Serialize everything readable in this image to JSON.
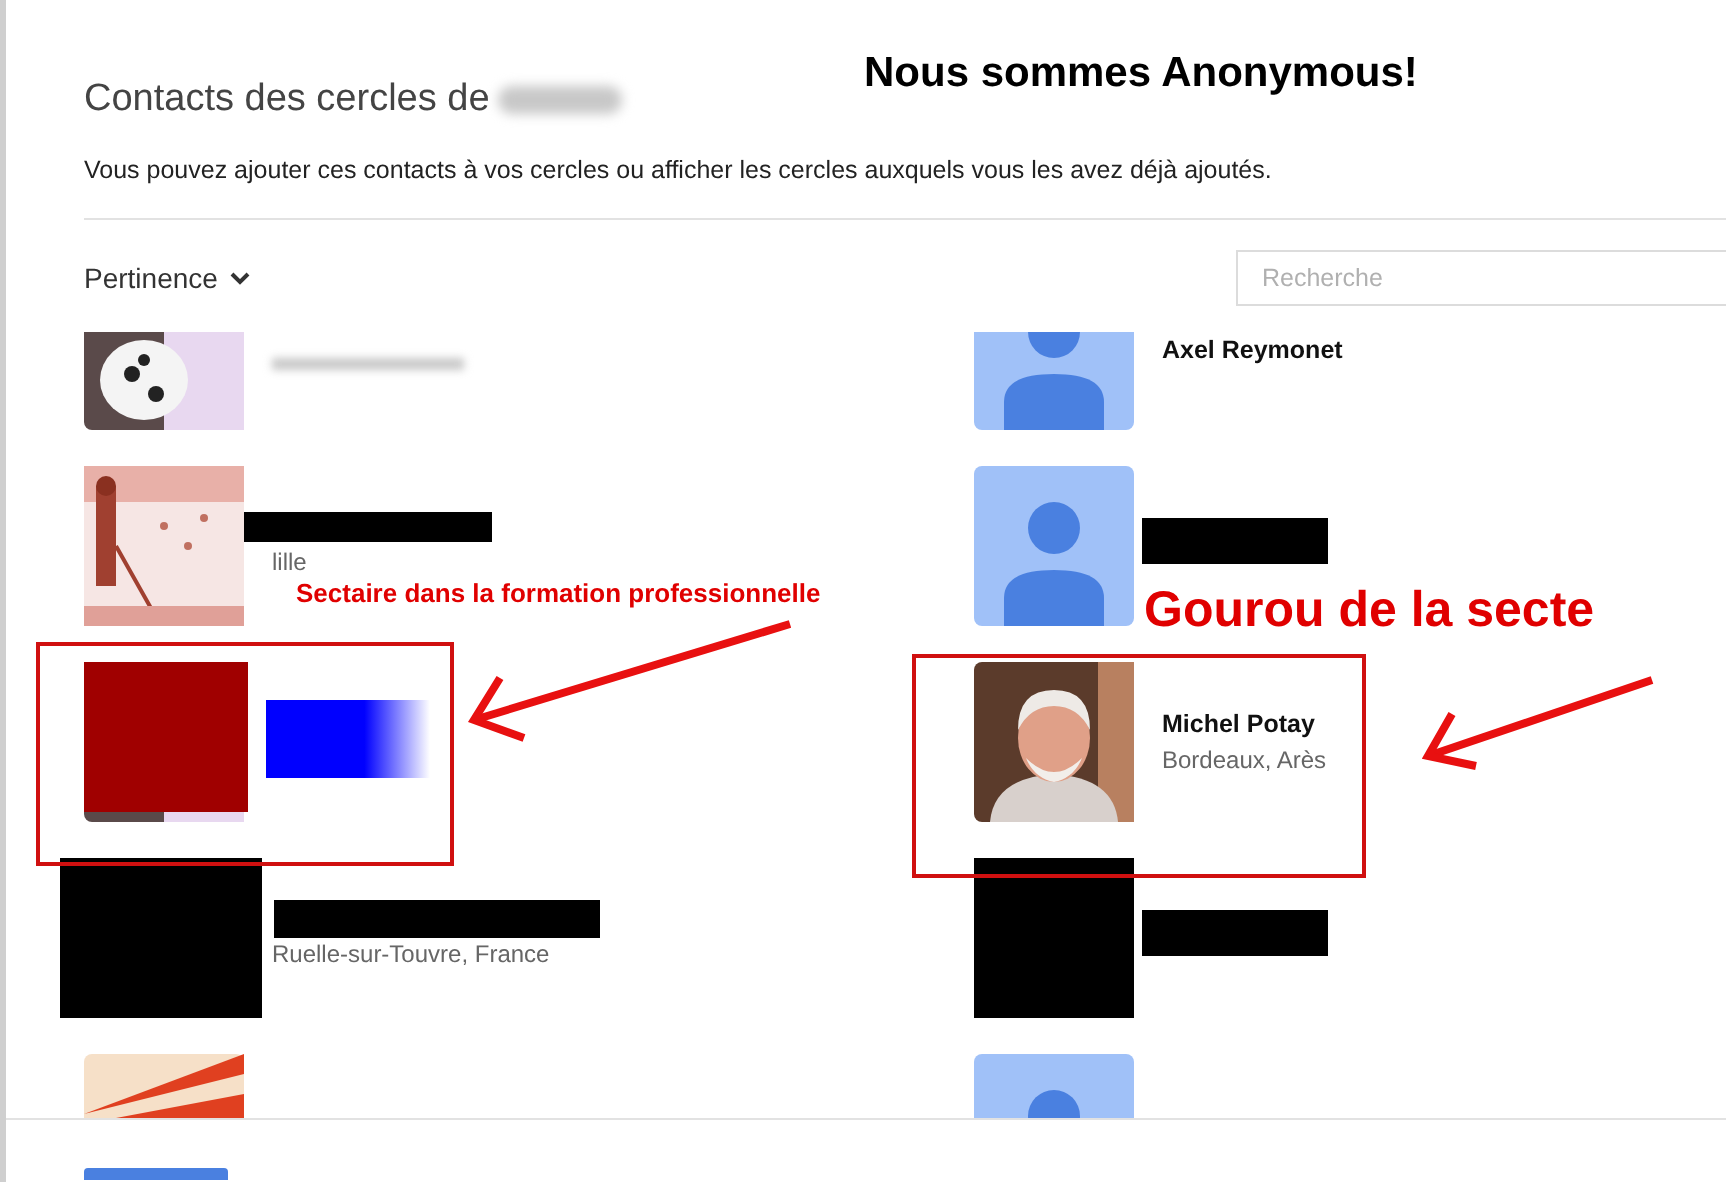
{
  "header": {
    "title": "Contacts des cercles de",
    "title_redaction": {
      "kind": "blur"
    },
    "subtitle": "Vous pouvez ajouter ces contacts à vos cercles ou afficher les cercles auxquels vous les avez déjà ajoutés."
  },
  "sort": {
    "label": "Pertinence"
  },
  "search": {
    "placeholder": "Recherche"
  },
  "contacts": [
    {
      "kind": "photo-dog",
      "redactions": [
        {
          "kind": "location-blur"
        }
      ]
    },
    {
      "kind": "default",
      "name": "Axel Reymonet"
    },
    {
      "kind": "photo-beach",
      "location": "lille",
      "redactions": [
        {
          "kind": "name-bar"
        }
      ]
    },
    {
      "kind": "default",
      "redactions": [
        {
          "kind": "name-bar-tall"
        }
      ]
    },
    {
      "kind": "photo-dog",
      "redactions": [
        {
          "kind": "photo-red"
        },
        {
          "kind": "name-blue"
        }
      ]
    },
    {
      "kind": "photo-man",
      "name": "Michel Potay",
      "location": "Bordeaux, Arès"
    },
    {
      "kind": "hidden",
      "location": "Ruelle-sur-Touvre, France",
      "redactions": [
        {
          "kind": "photo-black-wide"
        },
        {
          "kind": "name-bar-wide"
        }
      ]
    },
    {
      "kind": "hidden",
      "redactions": [
        {
          "kind": "photo-black"
        },
        {
          "kind": "name-bar-tall"
        }
      ]
    },
    {
      "kind": "photo-rays"
    },
    {
      "kind": "default"
    }
  ],
  "annotations": [
    {
      "kind": "headline",
      "text": "Nous sommes Anonymous!"
    },
    {
      "kind": "callout-small",
      "text": "Sectaire dans la formation professionnelle"
    },
    {
      "kind": "callout-large",
      "text": "Gourou de la secte"
    }
  ]
}
